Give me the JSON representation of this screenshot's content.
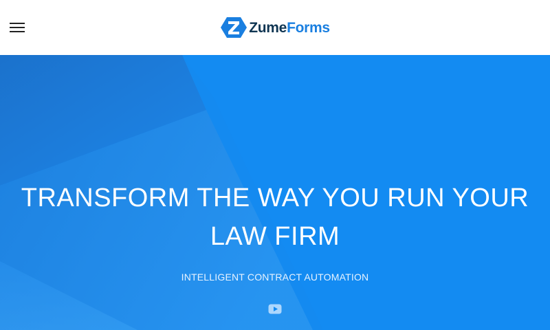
{
  "header": {
    "logo": {
      "brand_part1": "Zume",
      "brand_part2": "Forms"
    }
  },
  "hero": {
    "title_line1": "TRANSFORM THE WAY YOU RUN YOUR",
    "title_line2": "LAW FIRM",
    "subtitle": "INTELLIGENT CONTRACT AUTOMATION"
  },
  "icons": {
    "menu": "hamburger-menu-icon",
    "video": "youtube-play-icon"
  },
  "colors": {
    "hero_bg": "#138bf2",
    "brand_dark": "#0f3552",
    "brand_blue": "#1a7fe0"
  }
}
